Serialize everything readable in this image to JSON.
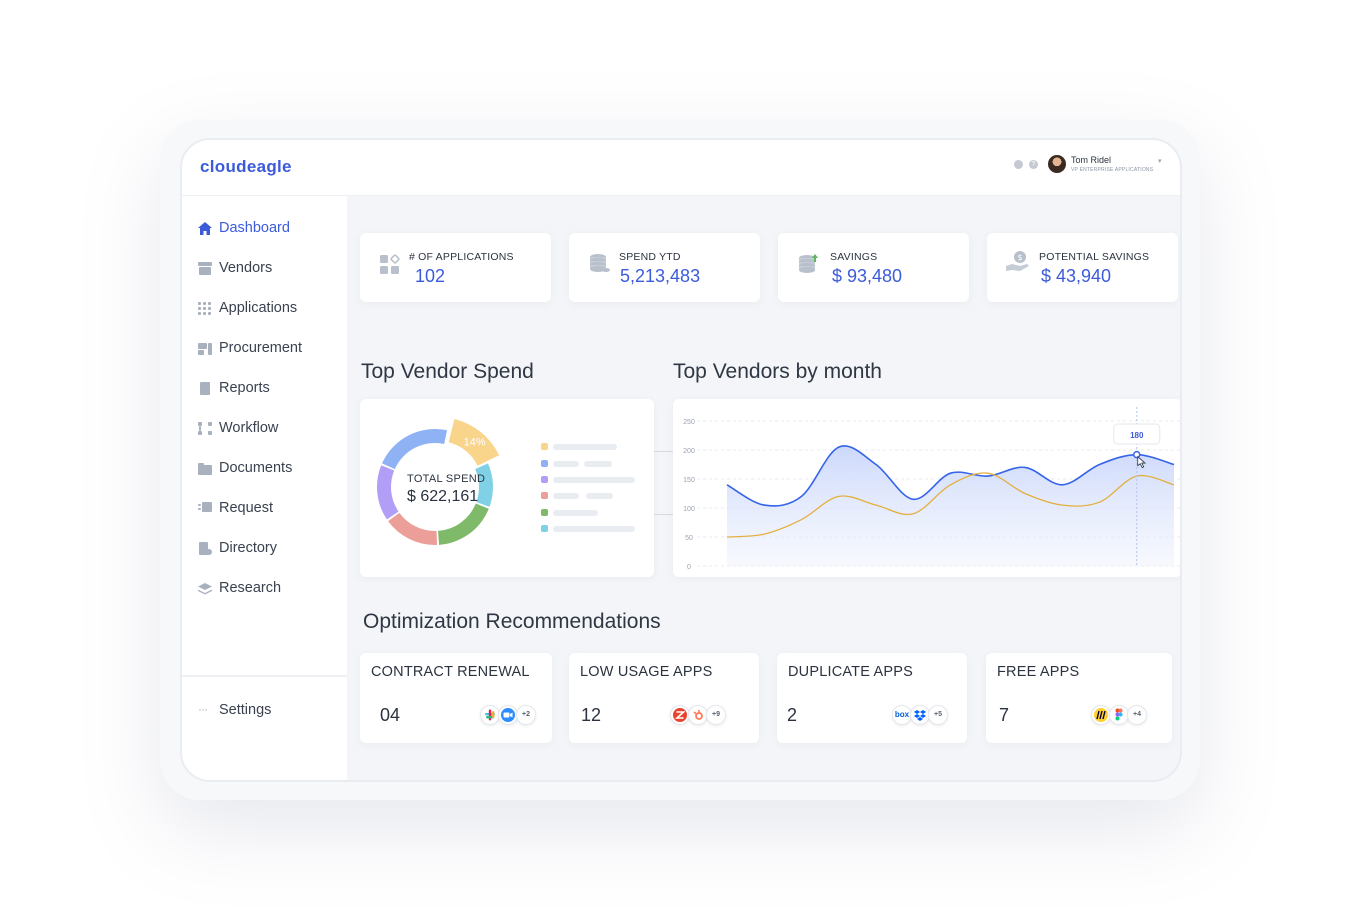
{
  "app": {
    "logo": "cloudeagle"
  },
  "user": {
    "name": "Tom Ridel",
    "role": "VP ENTERPRISE APPLICATIONS"
  },
  "sidebar": {
    "items": [
      {
        "label": "Dashboard",
        "icon": "home-icon",
        "active": true
      },
      {
        "label": "Vendors",
        "icon": "store-icon"
      },
      {
        "label": "Applications",
        "icon": "grid-icon"
      },
      {
        "label": "Procurement",
        "icon": "procurement-icon"
      },
      {
        "label": "Reports",
        "icon": "document-icon"
      },
      {
        "label": "Workflow",
        "icon": "workflow-icon"
      },
      {
        "label": "Documents",
        "icon": "folder-icon"
      },
      {
        "label": "Request",
        "icon": "request-icon"
      },
      {
        "label": "Directory",
        "icon": "directory-icon"
      },
      {
        "label": "Research",
        "icon": "layers-icon"
      }
    ],
    "settings": {
      "label": "Settings",
      "icon": "more-icon"
    }
  },
  "stats": [
    {
      "label": "# OF APPLICATIONS",
      "value": "102",
      "icon": "apps-icon"
    },
    {
      "label": "SPEND YTD",
      "value": "5,213,483",
      "icon": "coins-icon"
    },
    {
      "label": "SAVINGS",
      "value": "$ 93,480",
      "icon": "savings-icon"
    },
    {
      "label": "POTENTIAL SAVINGS",
      "value": "$ 43,940",
      "icon": "hand-coin-icon"
    }
  ],
  "sections": {
    "top_vendor_spend": "Top Vendor Spend",
    "top_vendors_by_month": "Top Vendors by month",
    "optimization": "Optimization Recommendations"
  },
  "donut": {
    "center_label": "TOTAL SPEND",
    "center_value": "$ 622,161",
    "highlight_label": "14%"
  },
  "colors": {
    "accent": "#3b5bdb",
    "donut": [
      "#f9d48b",
      "#8fb2f5",
      "#b39ef7",
      "#ec9f98",
      "#7fba6a",
      "#80d1e6"
    ],
    "line_blue": "#3563e9",
    "line_orange": "#e3b03f"
  },
  "chart_data": {
    "type": "area",
    "ylim": [
      0,
      250
    ],
    "yticks": [
      "0",
      "50",
      "100",
      "150",
      "200",
      "250"
    ],
    "tooltip": "180",
    "series": [
      {
        "values": [
          140,
          105,
          120,
          205,
          175,
          115,
          160,
          155,
          170,
          140,
          175,
          192,
          175
        ]
      },
      {
        "values": [
          50,
          55,
          80,
          120,
          105,
          90,
          140,
          160,
          125,
          105,
          110,
          155,
          140
        ]
      }
    ]
  },
  "recommendations": [
    {
      "title": "CONTRACT RENEWAL",
      "count": "04",
      "more": "+2",
      "apps": [
        "slack-icon",
        "zoom-icon"
      ]
    },
    {
      "title": "LOW USAGE APPS",
      "count": "12",
      "more": "+9",
      "apps": [
        "zendesk-icon",
        "hubspot-icon"
      ]
    },
    {
      "title": "DUPLICATE APPS",
      "count": "2",
      "more": "+5",
      "apps": [
        "box-icon",
        "dropbox-icon"
      ]
    },
    {
      "title": "FREE APPS",
      "count": "7",
      "more": "+4",
      "apps": [
        "miro-icon",
        "figma-icon"
      ]
    }
  ]
}
